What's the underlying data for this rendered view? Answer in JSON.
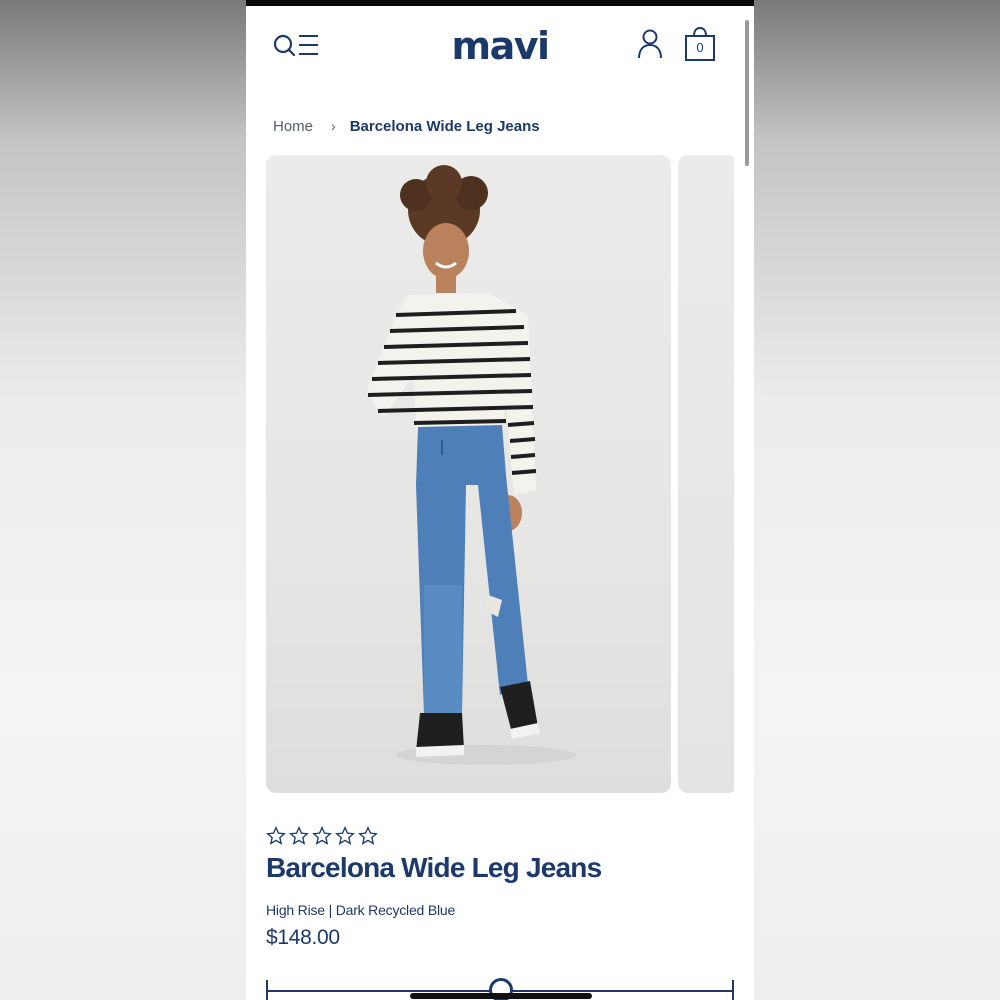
{
  "header": {
    "logo": "mavi",
    "bag_count": "0",
    "icons": [
      "search-icon",
      "menu-icon",
      "account-icon",
      "shopping-bag-icon"
    ]
  },
  "breadcrumb": {
    "home": "Home",
    "separator": "›",
    "current": "Barcelona Wide Leg Jeans"
  },
  "product": {
    "rating": "0 of 5",
    "title": "Barcelona Wide Leg Jeans",
    "subtitle": "High Rise | Dark Recycled Blue",
    "price": "$148.00"
  },
  "colors": {
    "brand": "#1b3a6b",
    "text_muted": "#555d68",
    "image_bg": "#e8e8e6"
  }
}
